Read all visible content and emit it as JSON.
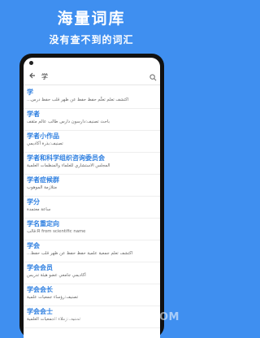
{
  "promo": {
    "title": "海量词库",
    "subtitle": "没有查不到的词汇"
  },
  "search": {
    "query": "学"
  },
  "icons": {
    "back": "back-arrow-icon",
    "search": "magnifier-icon"
  },
  "results": [
    {
      "head": "学",
      "def": "اكتشف  تعلم  تعلّم  حفظ  حفظ عن ظهر قلب  حفظ  درس..."
    },
    {
      "head": "学者",
      "def": "باحث  تصنيف:دارسون  دارس  طالب  عالم  مثقف"
    },
    {
      "head": "学者小作品",
      "def": "تصنيف:بذرة أكاديمي"
    },
    {
      "head": "学者和科学组织咨询委员会",
      "def": "المجلس الاستشاري للعلماء والمنظمات العلمية"
    },
    {
      "head": "学者症候群",
      "def": "متلازمة الموهوب"
    },
    {
      "head": "学分",
      "def": "ساعة معتمدة"
    },
    {
      "head": "学名重定向",
      "def": "R from scientific name:قالب"
    },
    {
      "head": "学会",
      "def": "اكتشف  تعلم  جمعية علمية  حفظ  حفظ عن ظهر قلب  حفظ..."
    },
    {
      "head": "学会会员",
      "def": "أكاديمي  جامعي  عضو هيئة تدريس"
    },
    {
      "head": "学会会长",
      "def": "تصنيف:رؤساء جمعيات علمية"
    },
    {
      "head": "学会会士",
      "def": "تصنيف:زملاء الجمعيات العلمية"
    }
  ],
  "watermark": "新疆资讯.SJXINYI.COM"
}
